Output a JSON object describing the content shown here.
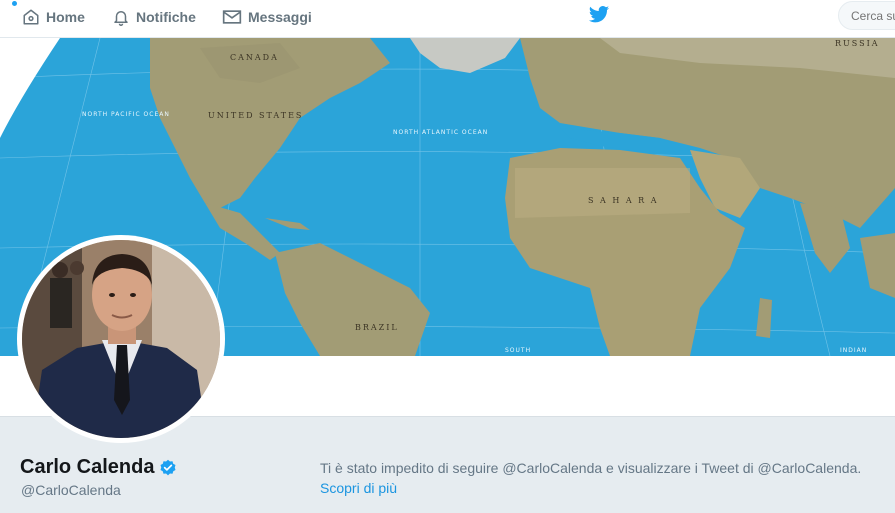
{
  "nav": {
    "home_label": "Home",
    "notifications_label": "Notifiche",
    "messages_label": "Messaggi"
  },
  "search": {
    "placeholder": "Cerca su"
  },
  "map_labels": {
    "canada": "CANADA",
    "united_states": "UNITED STATES",
    "north_pacific": "NORTH PACIFIC OCEAN",
    "north_atlantic": "NORTH ATLANTIC OCEAN",
    "brazil": "BRAZIL",
    "russia": "RUSSIA",
    "sahara": "S A H A R A",
    "south": "SOUTH",
    "indian": "INDIAN"
  },
  "profile": {
    "name": "Carlo Calenda",
    "handle": "@CarloCalenda",
    "blocked_notice": "Ti è stato impedito di seguire @CarloCalenda e visualizzare i Tweet di @CarloCalenda.",
    "learn_more": "Scopri di più"
  },
  "colors": {
    "accent": "#1da1f2",
    "link": "#1b95e0",
    "ocean": "#2aa3d8",
    "land": "#a8a07a"
  }
}
